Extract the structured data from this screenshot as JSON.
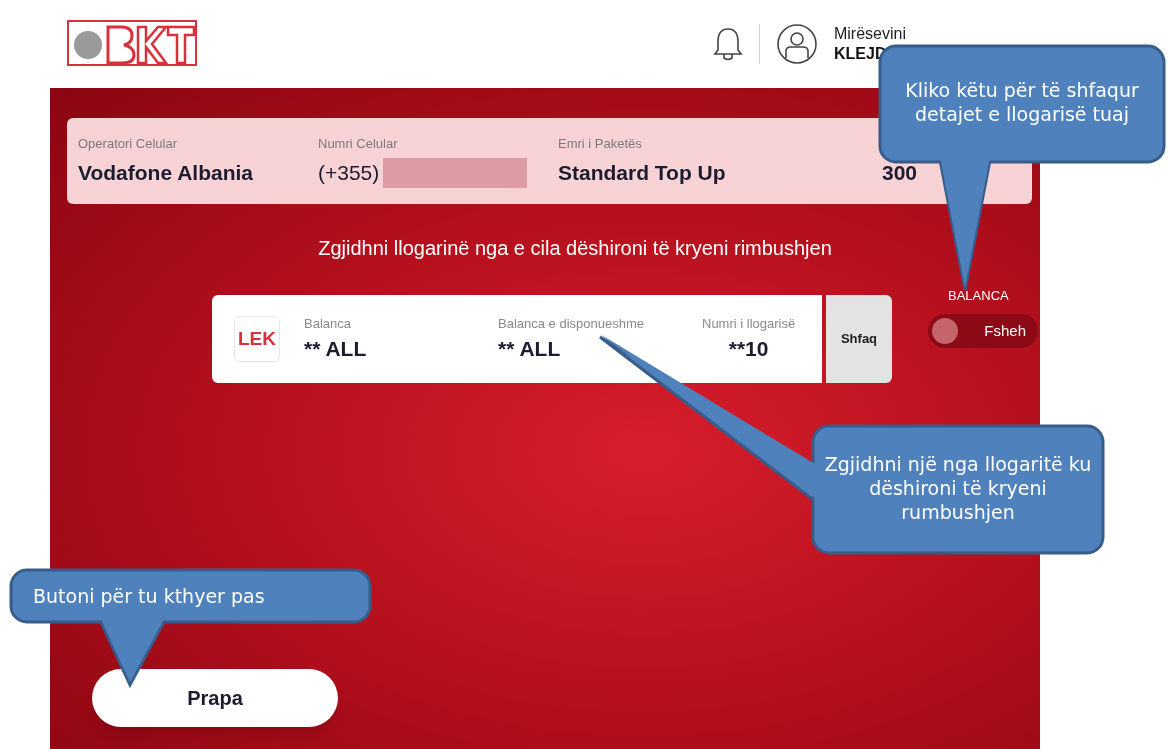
{
  "header": {
    "greeting": "Mirësevini",
    "user_name": "KLEJD"
  },
  "summary": {
    "fields": [
      {
        "label": "Operatori Celular",
        "value": "Vodafone Albania",
        "kind": "text"
      },
      {
        "label": "Numri Celular",
        "value": "(+355)",
        "kind": "masked"
      },
      {
        "label": "Emri i Paketës",
        "value": "Standard Top Up",
        "kind": "text"
      },
      {
        "value": "300",
        "kind": "amount"
      }
    ]
  },
  "instruction": "Zgjidhni llogarinë nga e cila dëshironi të kryeni rimbushjen",
  "account": {
    "currency_badge": "LEK",
    "columns": [
      {
        "label": "Balanca",
        "value": "** ALL"
      },
      {
        "label": "Balanca e disponueshme",
        "value": "** ALL"
      },
      {
        "label": "Numri i llogarisë",
        "value": "**10"
      }
    ],
    "show_button": "Shfaq"
  },
  "balance_toggle": {
    "label": "BALANCA",
    "state_text": "Fsheh",
    "on": false
  },
  "back_button": "Prapa",
  "callouts": [
    {
      "text": "Kliko këtu për të shfaqur detajet e llogarisë tuaj"
    },
    {
      "text": "Zgjidhni një nga llogaritë ku dëshironi të kryeni rumbushjen"
    },
    {
      "text": "Butoni për tu kthyer pas"
    }
  ]
}
